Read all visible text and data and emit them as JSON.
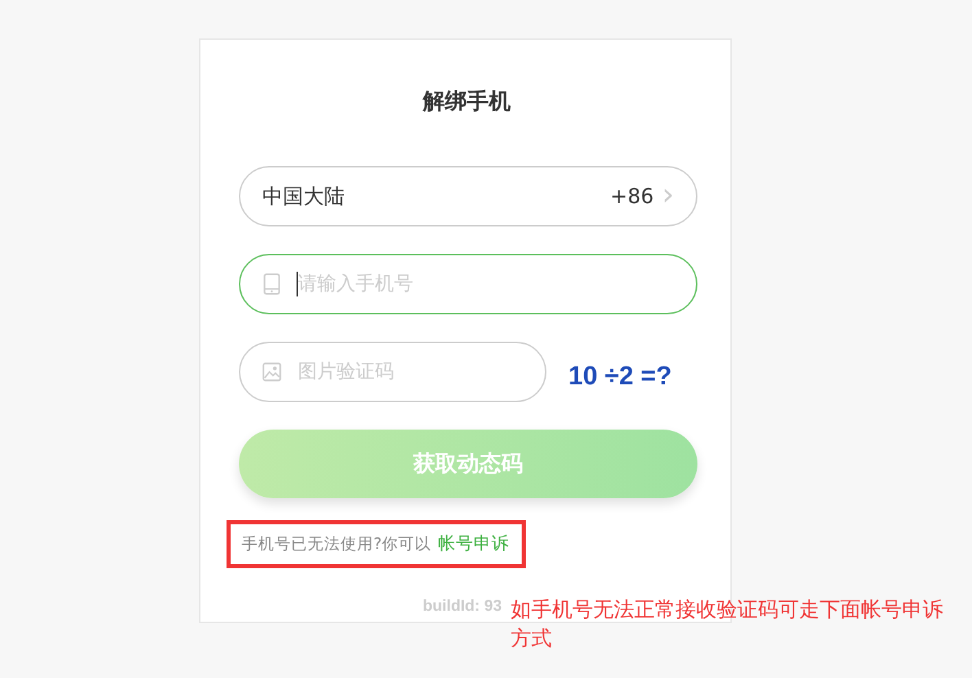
{
  "title": "解绑手机",
  "country": {
    "name": "中国大陆",
    "code": "+86",
    "chevron": "›"
  },
  "phone": {
    "placeholder": "请输入手机号",
    "focused": true
  },
  "captcha": {
    "placeholder": "图片验证码",
    "challenge": "10 ÷2 =?"
  },
  "submit": {
    "label": "获取动态码",
    "disabled": true
  },
  "help": {
    "text": "手机号已无法使用?你可以",
    "link": "帐号申诉",
    "highlighted": true
  },
  "build": "buildId: 93",
  "annotation": "如手机号无法正常接收验证码可走下面帐号申诉方式"
}
